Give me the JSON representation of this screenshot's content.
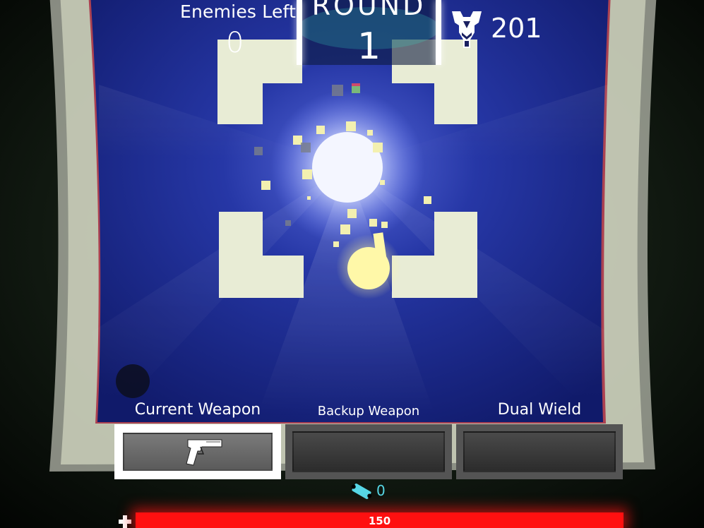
{
  "hud": {
    "enemies_left_label": "Enemies Left",
    "enemies_left_value": "0",
    "round_label": "ROUND",
    "round_value": "1",
    "score_icon": "trophy-crest-icon",
    "score_value": "201"
  },
  "weapons": {
    "current_label": "Current Weapon",
    "backup_label": "Backup Weapon",
    "dual_label": "Dual Wield",
    "current_icon": "pistol-icon"
  },
  "ammo": {
    "icon": "ammo-ticket-icon",
    "value": "0"
  },
  "health": {
    "icon": "health-cross-icon",
    "value": "150",
    "fill_fraction": 1.0
  },
  "colors": {
    "arena_blue": "#1c2a8c",
    "wall_cream": "#e8ecd5",
    "health_red": "#ff1010",
    "ammo_cyan": "#56d7e6",
    "player_yellow": "#fff8a8"
  }
}
